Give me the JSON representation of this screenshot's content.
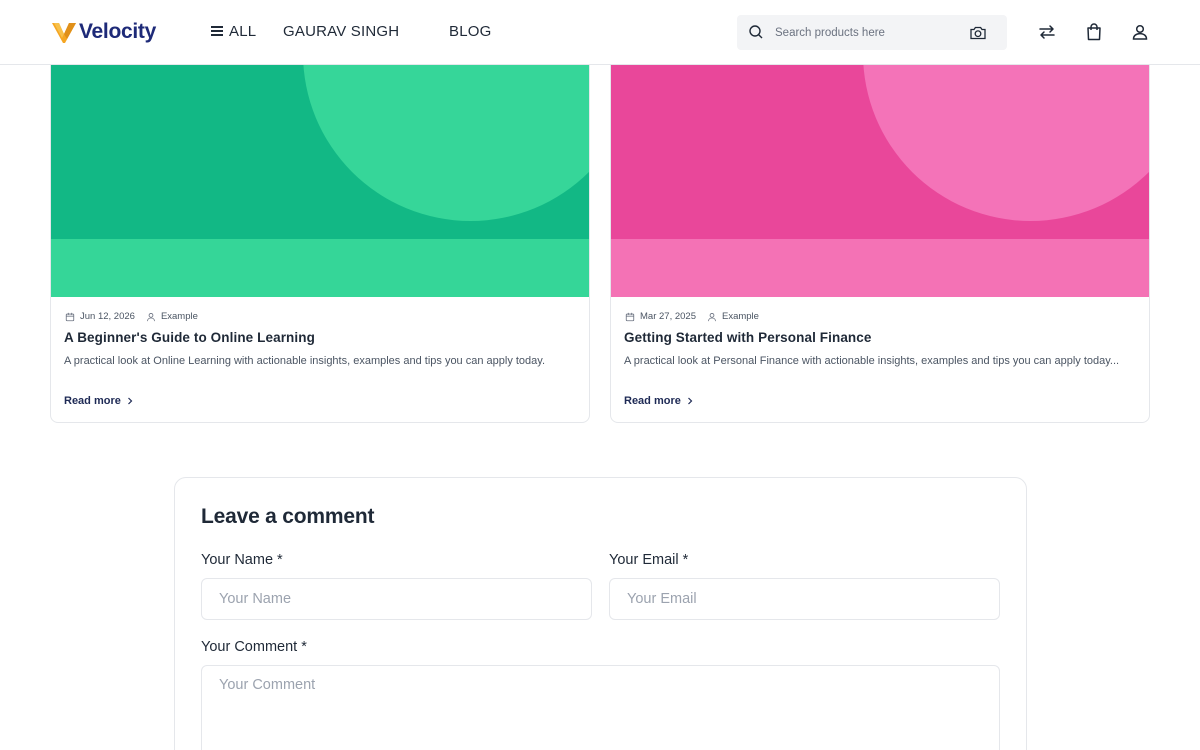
{
  "header": {
    "brand": "Velocity",
    "nav": {
      "all_label": "ALL",
      "user_label": "GAURAV SINGH",
      "blog_label": "BLOG"
    },
    "search": {
      "placeholder": "Search products here",
      "icon": "search-icon",
      "camera_icon": "camera-icon"
    },
    "icons": [
      "compare-icon",
      "bag-icon",
      "user-icon"
    ]
  },
  "posts": [
    {
      "date": "Jun 12, 2026",
      "author": "Example",
      "title": "A Beginner's Guide to Online Learning",
      "excerpt": "A practical look at Online Learning with actionable insights, examples and tips you can apply today.",
      "read_more": "Read more",
      "colors": {
        "base": "#12b885",
        "accent": "#36d699"
      }
    },
    {
      "date": "Mar 27, 2025",
      "author": "Example",
      "title": "Getting Started with Personal Finance",
      "excerpt": "A practical look at Personal Finance with actionable insights, examples and tips you can apply today...",
      "read_more": "Read more",
      "colors": {
        "base": "#e9479a",
        "accent": "#f473b8"
      }
    }
  ],
  "comment_form": {
    "title": "Leave a comment",
    "name_label": "Your Name *",
    "name_placeholder": "Your Name",
    "email_label": "Your Email *",
    "email_placeholder": "Your Email",
    "comment_label": "Your Comment *",
    "comment_placeholder": "Your Comment"
  },
  "colors": {
    "brand_navy": "#1e2a78",
    "brand_gold": "#f5a623"
  }
}
